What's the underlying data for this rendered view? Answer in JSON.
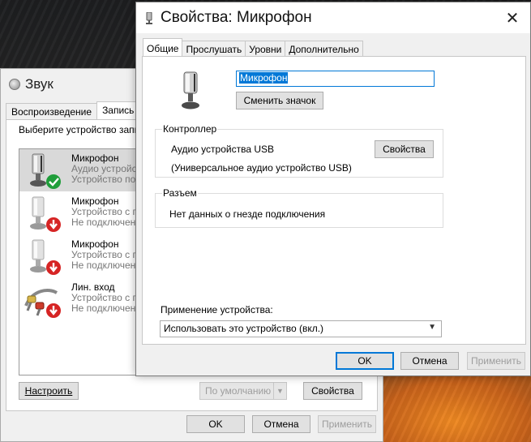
{
  "sound_window": {
    "title": "Звук",
    "tabs": [
      "Воспроизведение",
      "Запись",
      "З"
    ],
    "hint": "Выберите устройство запис",
    "devices": [
      {
        "name": "Микрофон",
        "line1": "Аудио устройст",
        "line2": "Устройство по",
        "status": "default",
        "icon": "microphone-icon"
      },
      {
        "name": "Микрофон",
        "line1": "Устройство с по",
        "line2": "Не подключено",
        "status": "disconnected",
        "icon": "microphone-icon"
      },
      {
        "name": "Микрофон",
        "line1": "Устройство с по",
        "line2": "Не подключено",
        "status": "disconnected",
        "icon": "microphone-icon"
      },
      {
        "name": "Лин. вход",
        "line1": "Устройство с по",
        "line2": "Не подключено",
        "status": "disconnected",
        "icon": "line-in-cable-icon"
      }
    ],
    "configure_button": "Настроить",
    "default_button": "По умолчанию",
    "properties_button": "Свойства",
    "ok_button": "OK",
    "cancel_button": "Отмена",
    "apply_button": "Применить"
  },
  "props_window": {
    "title": "Свойства: Микрофон",
    "tabs": [
      "Общие",
      "Прослушать",
      "Уровни",
      "Дополнительно"
    ],
    "active_tab": "Общие",
    "device_name": "Микрофон",
    "change_icon_button": "Сменить значок",
    "controller_group": {
      "legend": "Контроллер",
      "name": "Аудио устройства USB",
      "detail": "(Универсальное аудио устройство USB)",
      "properties_button": "Свойства"
    },
    "jack_group": {
      "legend": "Разъем",
      "text": "Нет данных о гнезде подключения"
    },
    "usage_label": "Применение устройства:",
    "usage_value": "Использовать это устройство (вкл.)",
    "ok_button": "OK",
    "cancel_button": "Отмена",
    "apply_button": "Применить"
  },
  "colors": {
    "accent": "#0078d7",
    "default_badge": "#1f9e3a",
    "disconnected_badge": "#d62424"
  }
}
